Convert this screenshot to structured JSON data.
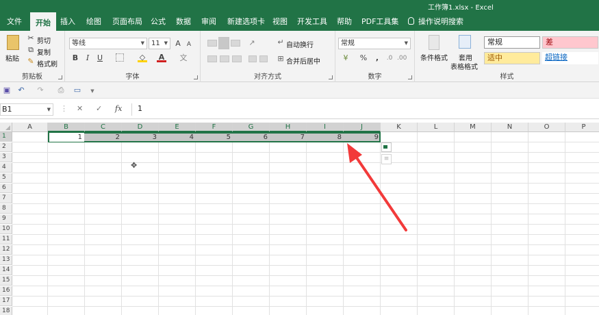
{
  "window": {
    "title": "工作簿1.xlsx  -  Excel"
  },
  "tabs": [
    {
      "label": "文件"
    },
    {
      "label": "开始"
    },
    {
      "label": "插入"
    },
    {
      "label": "绘图"
    },
    {
      "label": "页面布局"
    },
    {
      "label": "公式"
    },
    {
      "label": "数据"
    },
    {
      "label": "审阅"
    },
    {
      "label": "新建选项卡"
    },
    {
      "label": "视图"
    },
    {
      "label": "开发工具"
    },
    {
      "label": "帮助"
    },
    {
      "label": "PDF工具集"
    }
  ],
  "tell_me": "操作说明搜索",
  "ribbon": {
    "clipboard": {
      "paste": "粘贴",
      "cut": "剪切",
      "copy": "复制",
      "format_painter": "格式刷",
      "label": "剪贴板"
    },
    "font": {
      "name": "等线",
      "size": "11",
      "bold": "B",
      "italic": "I",
      "underline": "U",
      "label": "字体"
    },
    "alignment": {
      "wrap": "自动换行",
      "merge": "合并后居中",
      "label": "对齐方式"
    },
    "number": {
      "format": "常规",
      "percent": "%",
      "comma": ",",
      "label": "数字"
    },
    "styles": {
      "conditional": "条件格式",
      "table1": "套用",
      "table2": "表格格式",
      "normal": "常规",
      "bad": "差",
      "neutral": "适中",
      "hyperlink": "超链接",
      "label": "样式"
    }
  },
  "formula_bar": {
    "name_box": "B1",
    "fx": "fx",
    "value": "1"
  },
  "columns": [
    "A",
    "B",
    "C",
    "D",
    "E",
    "F",
    "G",
    "H",
    "I",
    "J",
    "K",
    "L",
    "M",
    "N",
    "O",
    "P"
  ],
  "rows": [
    "1",
    "2",
    "3",
    "4",
    "5",
    "6",
    "7",
    "8",
    "9",
    "10",
    "11",
    "12",
    "13",
    "14",
    "15",
    "16",
    "17",
    "18"
  ],
  "row1_values": [
    "1",
    "2",
    "3",
    "4",
    "5",
    "6",
    "7",
    "8",
    "9"
  ],
  "colors": {
    "brand": "#217346",
    "selection": "#c6c6c6",
    "arrow": "#f23a3a"
  }
}
